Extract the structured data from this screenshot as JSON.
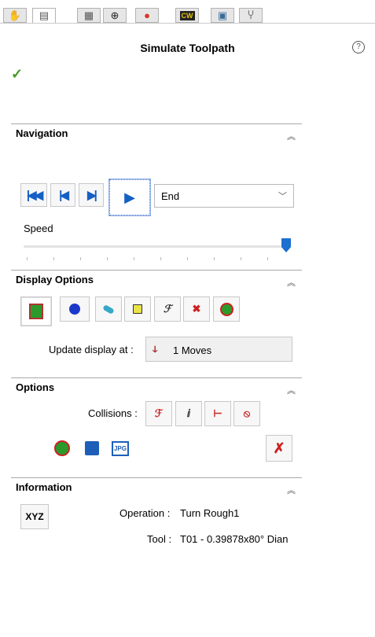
{
  "tabs": [
    {
      "name": "feature-manager-tab",
      "icon": "hand-icon",
      "glyph": "✋",
      "active": false
    },
    {
      "name": "property-manager-tab",
      "icon": "property-manager-icon",
      "glyph": "▤",
      "active": true
    },
    {
      "name": "configuration-manager-tab",
      "icon": "configuration-icon",
      "glyph": "▦",
      "active": false
    },
    {
      "name": "dimxpert-tab",
      "icon": "crosshair-icon",
      "glyph": "⊕",
      "active": false
    },
    {
      "name": "display-manager-tab",
      "icon": "appearance-icon",
      "glyph": "●",
      "active": false
    },
    {
      "name": "cam-feature-tree-tab",
      "icon": "cam-icon",
      "glyph": "CW",
      "active": false
    },
    {
      "name": "cam-operation-tree-tab",
      "icon": "operation-tree-icon",
      "glyph": "▣",
      "active": false
    },
    {
      "name": "cam-tool-tree-tab",
      "icon": "tool-tree-icon",
      "glyph": "Ⴤ",
      "active": false
    }
  ],
  "title": "Simulate Toolpath",
  "help_icon": "help-icon",
  "ok_icon": "checkmark-icon",
  "navigation": {
    "heading": "Navigation",
    "play_to": "End",
    "speed_label": "Speed",
    "speed_level": 0.97,
    "buttons": [
      "go-to-start-icon",
      "step-back-icon",
      "step-forward-icon",
      "play-icon"
    ]
  },
  "display_options": {
    "heading": "Display Options",
    "update_label": "Update display at :",
    "update_value": "1 Moves",
    "buttons": [
      "part-display-icon",
      "stock-display-icon",
      "tool-display-icon",
      "holder-display-icon",
      "tool-holder-icon",
      "collision-icon",
      "toolpath-display-icon"
    ]
  },
  "options": {
    "heading": "Options",
    "collisions_label": "Collisions :",
    "collision_buttons": [
      "tool-collision-icon",
      "holder-collision-icon",
      "shank-collision-icon",
      "no-collision-icon"
    ],
    "buttons": [
      "compare-stock-icon",
      "save-stl-icon",
      "save-jpg-icon",
      "settings-icon"
    ]
  },
  "information": {
    "heading": "Information",
    "xyz_label": "XYZ",
    "operation_label": "Operation :",
    "operation_value": "Turn Rough1",
    "tool_label": "Tool :",
    "tool_value": "T01 - 0.39878x80° Dian"
  },
  "colors": {
    "accent": "#1d6fd1",
    "check": "#3e9c1d"
  }
}
